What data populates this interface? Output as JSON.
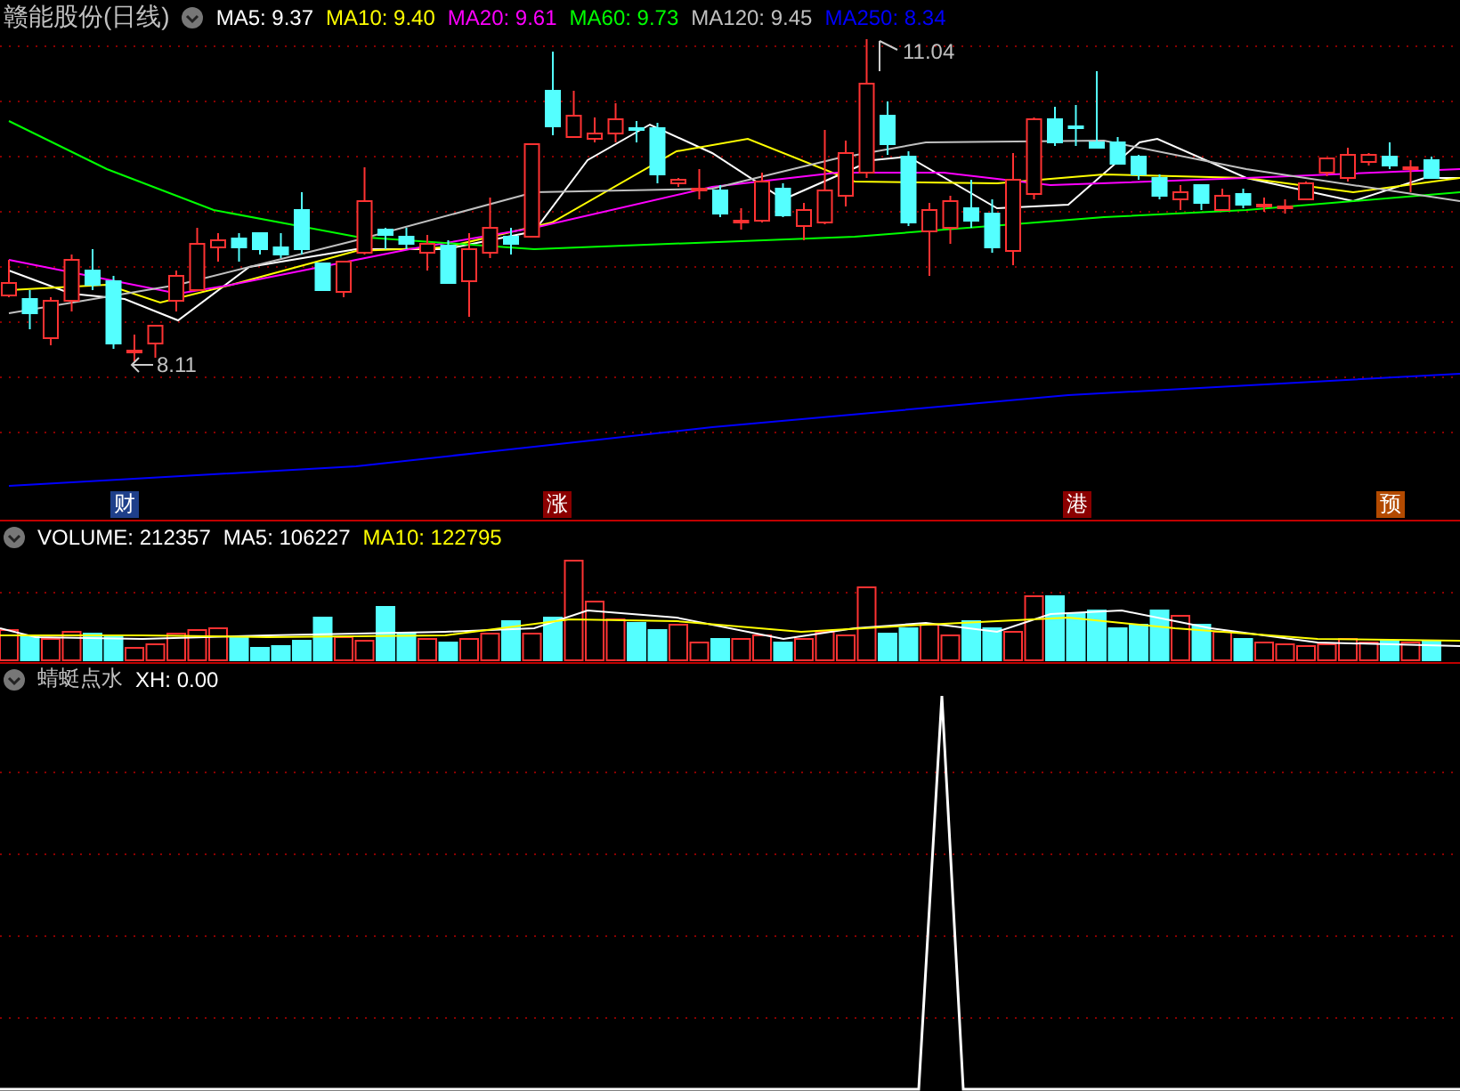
{
  "header": {
    "title": "赣能股份(日线)",
    "indicators": [
      {
        "label": "MA5: 9.37",
        "color": "#ffffff"
      },
      {
        "label": "MA10: 9.40",
        "color": "#ffff00"
      },
      {
        "label": "MA20: 9.61",
        "color": "#ff00ff"
      },
      {
        "label": "MA60: 9.73",
        "color": "#00ff00"
      },
      {
        "label": "MA120: 9.45",
        "color": "#c0c0c0"
      },
      {
        "label": "MA250: 8.34",
        "color": "#0000ff"
      }
    ]
  },
  "price_chart": {
    "high_label": "11.04",
    "low_label": "8.11"
  },
  "event_markers": [
    {
      "label": "财",
      "color": "#1e3f8a"
    },
    {
      "label": "涨",
      "color": "#8b0000"
    },
    {
      "label": "港",
      "color": "#8b0000"
    },
    {
      "label": "预",
      "color": "#b34a00"
    }
  ],
  "volume": {
    "indicators": [
      {
        "label": "VOLUME: 212357",
        "color": "#ffffff"
      },
      {
        "label": "MA5: 106227",
        "color": "#ffffff"
      },
      {
        "label": "MA10: 122795",
        "color": "#ffff00"
      }
    ]
  },
  "indicator_panel": {
    "indicators": [
      {
        "label": "蜻蜓点水",
        "color": "#c0c0c0"
      },
      {
        "label": "XH: 0.00",
        "color": "#ffffff"
      }
    ]
  }
}
